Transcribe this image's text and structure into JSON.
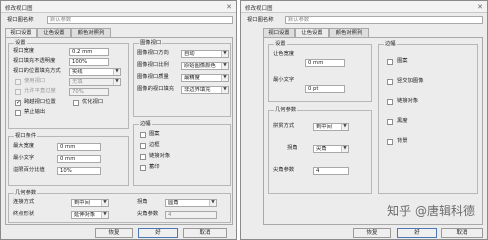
{
  "left": {
    "title": "修改视口图",
    "name_label": "视口图名称",
    "name_placeholder": "默认参数",
    "tabs": [
      "视口设置",
      "让色设置",
      "颜色对照列"
    ],
    "settings": {
      "title": "设置",
      "width_label": "视口宽度",
      "width_value": "0.2 mm",
      "opacity_label": "视口填充不透明度",
      "opacity_value": "100%",
      "shape_label": "视口的位置填充方式",
      "shape_value": "实线",
      "hatch_label": "使用视口",
      "hatch_value": "无填",
      "scale_label": "允许平直过度",
      "scale_value": "70%",
      "dash_label": "跨越视口位置",
      "optim_label": "优化视口",
      "forbid_label": "禁止输出"
    },
    "render": {
      "title": "图像视口",
      "direction_label": "图像视口方向",
      "direction_value": "自动",
      "method_label": "图像视口比例",
      "method_value": "原始图像颜色",
      "quality_label": "图像视口质量",
      "quality_value": "最精度",
      "fill_label": "图像的视口填充",
      "fill_value": "非边界填充"
    },
    "margin": {
      "title": "边幅",
      "items": [
        "图案",
        "边框",
        "链接对象",
        "蓄印"
      ]
    },
    "conditions": {
      "title": "视口条件",
      "width_label": "最大宽度",
      "width_value": "0 mm",
      "minsize_label": "最小文字",
      "minsize_value": "0 mm",
      "ratio_label": "溢限百分比值",
      "ratio_value": "10%"
    },
    "geometry": {
      "title": "几何参数",
      "connect_label": "连接方式",
      "connect_value": "到中间",
      "shape_label": "拐角",
      "shape_value": "圆角",
      "endpoint_label": "终点形状",
      "endpoint_value": "延伸对象",
      "cap_label": "尖角参数",
      "cap_value": "4"
    },
    "buttons": [
      "恢复",
      "好",
      "取消"
    ]
  },
  "right": {
    "title": "修改视口图",
    "name_label": "视口图名称",
    "name_placeholder": "默认参数",
    "tabs": [
      "视口设置",
      "让色设置",
      "颜色对照列"
    ],
    "settings": {
      "title": "设置",
      "color_label": "让色宽度",
      "color_value": "0 mm",
      "minsize_label": "最小文字",
      "minsize_value": "0 pt"
    },
    "margin": {
      "title": "边幅",
      "items": [
        "图案",
        "竖交加图像",
        "链接对象",
        "黑度",
        "背景"
      ]
    },
    "geometry": {
      "title": "几何参数",
      "connect_label": "拼贯方式",
      "connect_value": "到中间",
      "corner_label": "拐角",
      "corner_value": "尖角",
      "cap_label": "尖角参数",
      "cap_value": "4"
    },
    "buttons": [
      "恢复",
      "好",
      "取消"
    ]
  },
  "watermark": "知乎 @唐辑科德",
  "colors": {
    "window_bg": "#ececec",
    "default_button_border": "#4d78b5"
  }
}
